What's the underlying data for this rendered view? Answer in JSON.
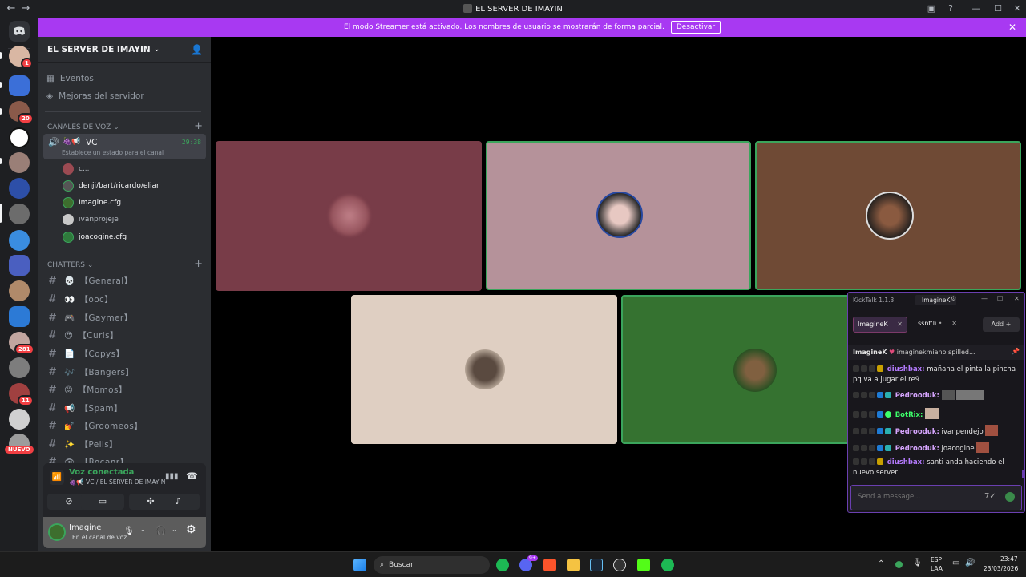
{
  "window": {
    "title": "EL SERVER DE IMAYIN"
  },
  "colors": {
    "accent": "#a839f2",
    "speaking": "#3ba55c",
    "sidebar": "#2b2d31",
    "guildbar": "#1e1f22"
  },
  "banner": {
    "text": "El modo Streamer está activado. Los nombres de usuario se mostrarán de forma parcial.",
    "button": "Desactivar"
  },
  "guilds": {
    "badges": [
      "1",
      "20",
      "281",
      "11"
    ],
    "new_label": "NUEVO"
  },
  "server": {
    "name": "EL SERVER DE IMAYIN"
  },
  "sidebar": {
    "events": "Eventos",
    "boosts": "Mejoras del servidor",
    "voice_category": "Canales de voz",
    "vc": {
      "name": "VC",
      "timer": "29:38",
      "status": "Establece un estado para el canal"
    },
    "voice_users": [
      "c...",
      "denji/bart/ricardo/elian",
      "Imagine.cfg",
      "ivanprojeje",
      "joacogine.cfg"
    ],
    "text_category": "CHATTERS",
    "channels": [
      {
        "icon": "💀",
        "name": "【General】"
      },
      {
        "icon": "👀",
        "name": "【ooc】"
      },
      {
        "icon": "🎮",
        "name": "【Gaymer】"
      },
      {
        "icon": "😍",
        "name": "【Curis】"
      },
      {
        "icon": "📄",
        "name": "【Copys】"
      },
      {
        "icon": "🎶",
        "name": "【Bangers】"
      },
      {
        "icon": "😡",
        "name": "【Momos】"
      },
      {
        "icon": "📢",
        "name": "【Spam】"
      },
      {
        "icon": "💅",
        "name": "【Groomeos】"
      },
      {
        "icon": "✨",
        "name": "【Pelis】"
      },
      {
        "icon": "👁",
        "name": "【Rocanr】"
      }
    ]
  },
  "voice_panel": {
    "status": "Voz conectada",
    "channel": "VC / EL SERVER DE IMAYIN"
  },
  "user_panel": {
    "name": "Imagine",
    "status": "En el canal de voz"
  },
  "kicktalk": {
    "title": "KickTalk 1.1.3",
    "account": "ImagineK",
    "tabs": [
      {
        "label": "ImagineK"
      },
      {
        "label": "ssnt'li"
      }
    ],
    "add_label": "Add",
    "pinned_user": "ImagineK",
    "pinned_text": "imaginekmiano spilled...",
    "messages": [
      {
        "user": "diushbax:",
        "color": "#b57bff",
        "text": "mañana el pinta la pincha pq va a jugar el re9"
      },
      {
        "user": "Pedrooduk:",
        "color": "#d7a6ff",
        "text": ""
      },
      {
        "user": "BotRix:",
        "color": "#3dff6a",
        "text": ""
      },
      {
        "user": "Pedrooduk:",
        "color": "#d7a6ff",
        "text": "ivanpendejo"
      },
      {
        "user": "Pedrooduk:",
        "color": "#d7a6ff",
        "text": "joacogine"
      },
      {
        "user": "diushbax:",
        "color": "#b57bff",
        "text": "santi anda haciendo el nuevo server"
      }
    ],
    "input_placeholder": "Send a message..."
  },
  "taskbar": {
    "search": "Buscar",
    "lang1": "ESP",
    "lang2": "LAA",
    "time": "23:47",
    "date": "23/03/2026",
    "discord_badge": "9+"
  }
}
